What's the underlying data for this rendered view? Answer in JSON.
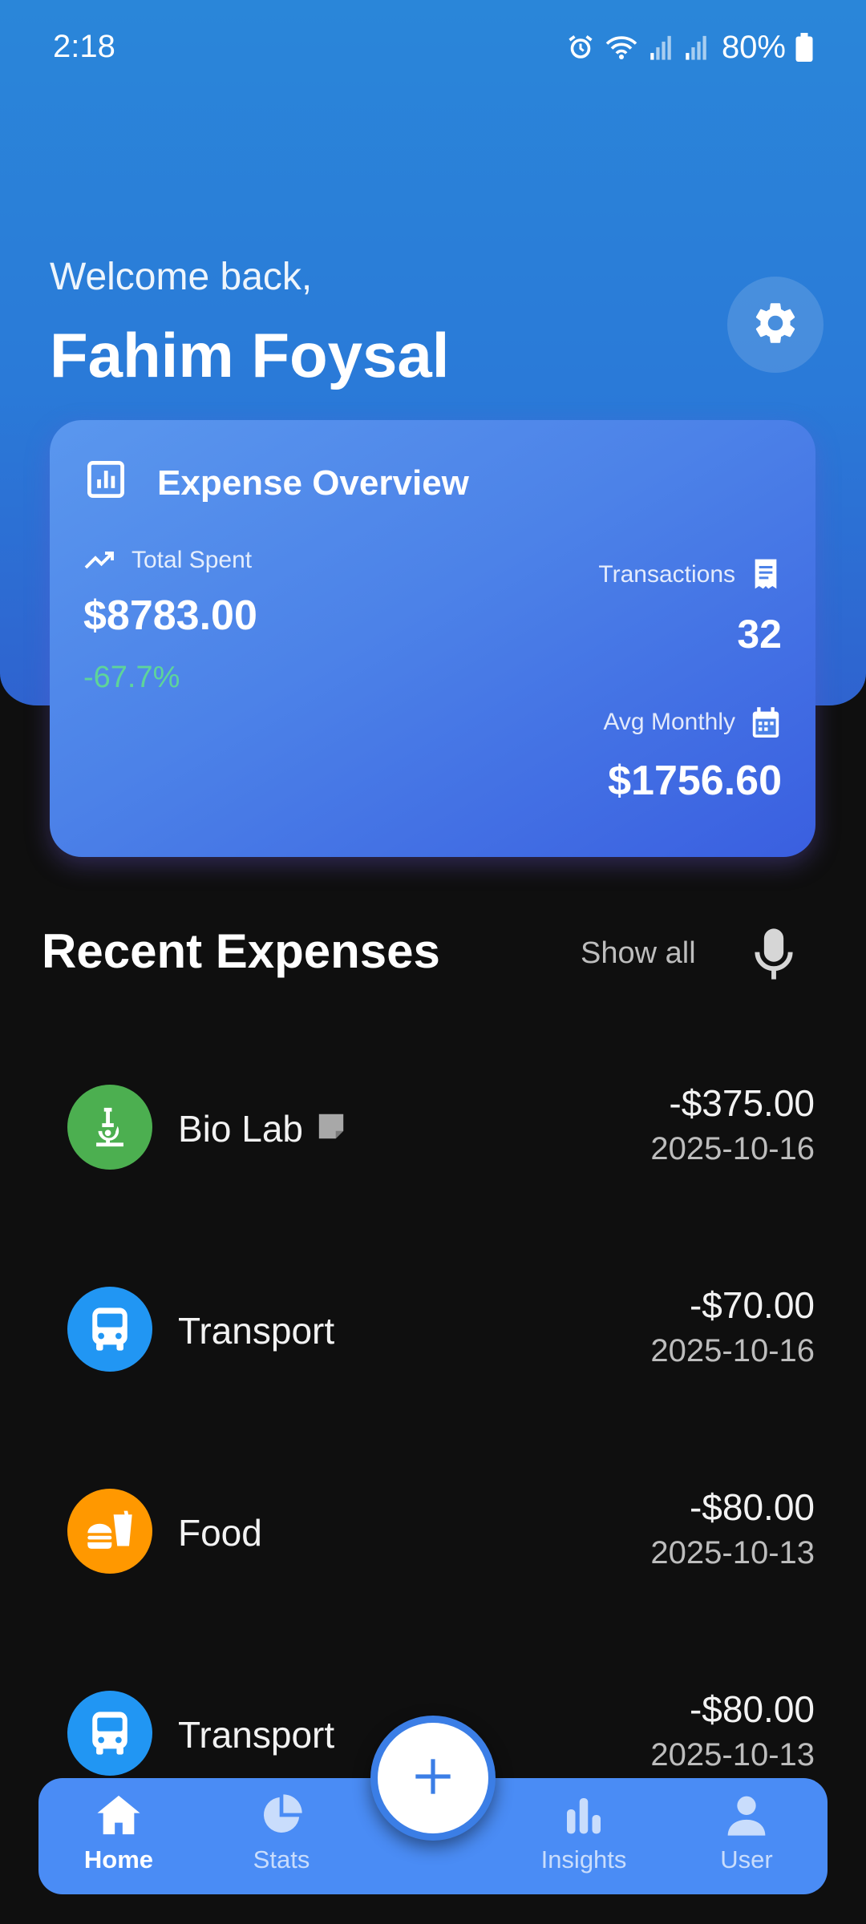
{
  "status_bar": {
    "time": "2:18",
    "battery": "80%"
  },
  "header": {
    "welcome": "Welcome back,",
    "user_name": "Fahim Foysal"
  },
  "overview": {
    "title": "Expense Overview",
    "total_label": "Total Spent",
    "total_value": "$8783.00",
    "total_change": "-67.7%",
    "transactions_label": "Transactions",
    "transactions_value": "32",
    "avg_label": "Avg Monthly",
    "avg_value": "$1756.60"
  },
  "recent": {
    "title": "Recent Expenses",
    "show_all": "Show all",
    "items": [
      {
        "name": "Bio Lab",
        "amount": "-$375.00",
        "date": "2025-10-16",
        "icon": "microscope-icon",
        "color": "#4caf50",
        "has_note": true
      },
      {
        "name": "Transport",
        "amount": "-$70.00",
        "date": "2025-10-16",
        "icon": "bus-icon",
        "color": "#2196f3",
        "has_note": false
      },
      {
        "name": "Food",
        "amount": "-$80.00",
        "date": "2025-10-13",
        "icon": "fastfood-icon",
        "color": "#ff9800",
        "has_note": false
      },
      {
        "name": "Transport",
        "amount": "-$80.00",
        "date": "2025-10-13",
        "icon": "bus-icon",
        "color": "#2196f3",
        "has_note": false
      }
    ]
  },
  "nav": {
    "items": [
      {
        "label": "Home",
        "icon": "home-icon",
        "active": true
      },
      {
        "label": "Stats",
        "icon": "pie-chart-icon",
        "active": false
      },
      {
        "label": "Insights",
        "icon": "bar-chart-icon",
        "active": false
      },
      {
        "label": "User",
        "icon": "person-icon",
        "active": false
      }
    ]
  },
  "colors": {
    "accent": "#4a8cf5",
    "header": "#2a7ad8",
    "positive_change": "#5ed49a"
  }
}
